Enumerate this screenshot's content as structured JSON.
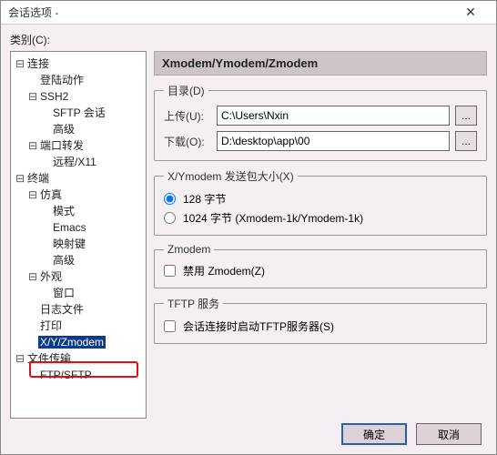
{
  "window": {
    "title": "会话选项  -"
  },
  "category_label": "类别(C):",
  "tree": {
    "n_connection": "连接",
    "n_login": "登陆动作",
    "n_ssh2": "SSH2",
    "n_sftp": "SFTP 会话",
    "n_ssh_adv": "高级",
    "n_portfwd": "端口转发",
    "n_remote": "远程/X11",
    "n_terminal": "终端",
    "n_emu": "仿真",
    "n_mode": "模式",
    "n_emacs": "Emacs",
    "n_mapkey": "映射键",
    "n_term_adv": "高级",
    "n_appear": "外观",
    "n_window": "窗口",
    "n_logfile": "日志文件",
    "n_print": "打印",
    "n_xyz": "X/Y/Zmodem",
    "n_filetx": "文件传输",
    "n_ftp": "FTP/SFTP"
  },
  "header": "Xmodem/Ymodem/Zmodem",
  "dir": {
    "legend": "目录(D)",
    "upload_label": "上传(U):",
    "upload_value": "C:\\Users\\Nxin",
    "download_label": "下载(O):",
    "download_value": "D:\\desktop\\app\\00",
    "browse": "..."
  },
  "xy": {
    "legend": "X/Ymodem 发送包大小(X)",
    "opt128": "128 字节",
    "opt1024": "1024 字节  (Xmodem-1k/Ymodem-1k)"
  },
  "zmodem": {
    "legend": "Zmodem",
    "disable": "禁用 Zmodem(Z)"
  },
  "tftp": {
    "legend": "TFTP 服务",
    "startup": "会话连接时启动TFTP服务器(S)"
  },
  "buttons": {
    "ok": "确定",
    "cancel": "取消"
  }
}
